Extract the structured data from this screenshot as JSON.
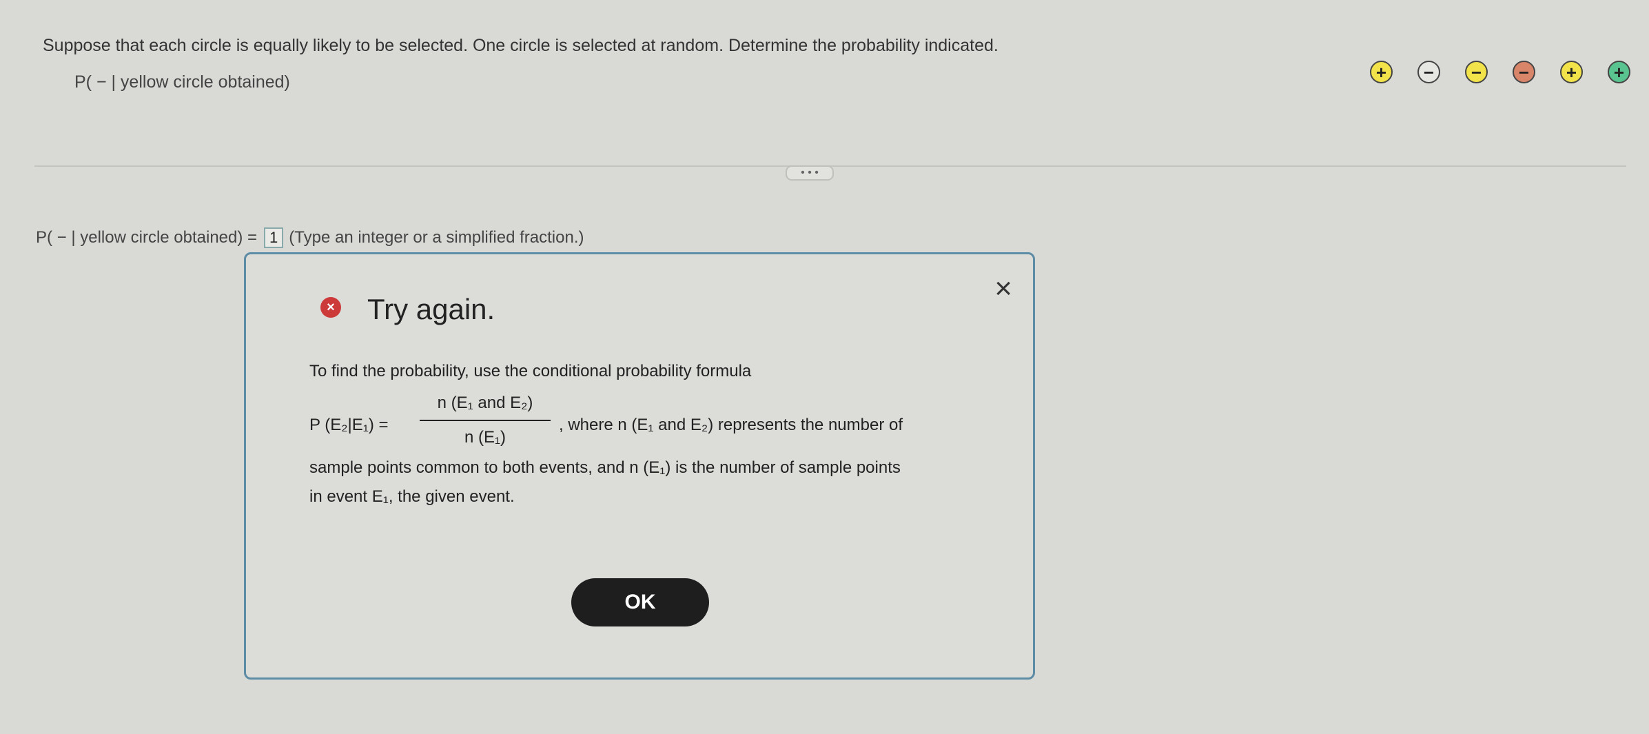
{
  "question": {
    "text": "Suppose that each circle is equally likely to be selected. One circle is selected at random. Determine the probability indicated.",
    "prompt": "P( − | yellow circle obtained)"
  },
  "circles": [
    {
      "symbol": "+",
      "color": "#f2e34a"
    },
    {
      "symbol": "−",
      "color": "#e6e6e2"
    },
    {
      "symbol": "−",
      "color": "#f2e34a"
    },
    {
      "symbol": "−",
      "color": "#d9856a"
    },
    {
      "symbol": "+",
      "color": "#f2e34a"
    },
    {
      "symbol": "+",
      "color": "#59c48f"
    }
  ],
  "expander": {
    "label": "• • •"
  },
  "answer": {
    "prefix": "P( − | yellow circle obtained) =",
    "value": "1",
    "hint": "(Type an integer or a simplified fraction.)"
  },
  "dialog": {
    "close": "×",
    "error_icon": "×",
    "title": "Try again.",
    "line1": "To find the probability, use the conditional probability formula",
    "formula_left": "P (E₂|E₁) =",
    "formula_num": "n (E₁ and E₂)",
    "formula_den": "n (E₁)",
    "formula_right": ", where n (E₁ and E₂) represents the number of",
    "line3": "sample points common to both events, and n (E₁) is the number of sample points",
    "line4": "in event E₁, the given event.",
    "ok_label": "OK"
  }
}
